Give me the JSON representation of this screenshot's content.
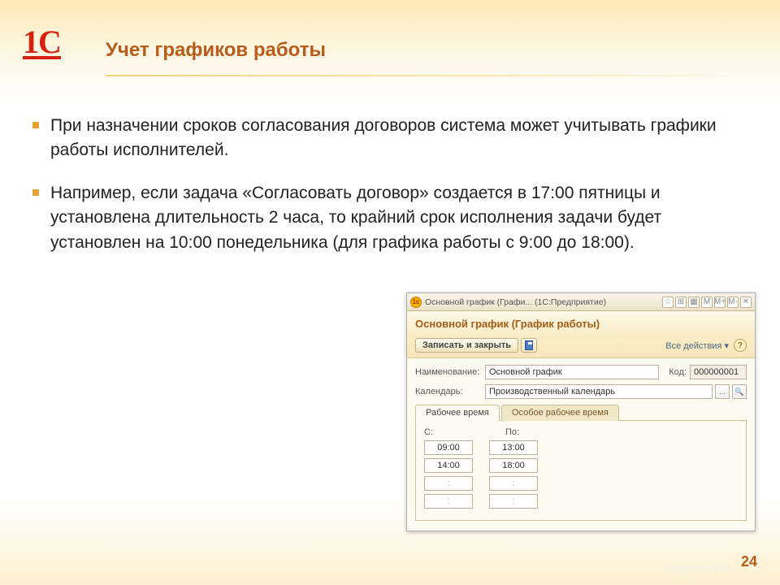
{
  "logo_text": "1C",
  "title": "Учет графиков работы",
  "bullets": [
    "При назначении сроков согласования договоров система может учитывать графики работы исполнителей.",
    "Например, если задача «Согласовать договор» создается в 17:00 пятницы и установлена длительность 2 часа, то крайний срок исполнения задачи будет установлен на 10:00 понедельника (для графика работы с 9:00 до 18:00)."
  ],
  "screenshot": {
    "titlebar": "Основной график (Графи... (1С:Предприятие)",
    "titlebar_buttons": [
      "☆",
      "⊞",
      "▦",
      "M",
      "M+",
      "M-",
      "✕"
    ],
    "header": "Основной график (График работы)",
    "toolbar": {
      "save_close": "Записать и закрыть",
      "all_actions": "Все действия ▾"
    },
    "fields": {
      "name_label": "Наименование:",
      "name_value": "Основной график",
      "code_label": "Код:",
      "code_value": "000000001",
      "calendar_label": "Календарь:",
      "calendar_value": "Производственный календарь"
    },
    "tabs": {
      "work_time": "Рабочее время",
      "special_time": "Особое рабочее время"
    },
    "time": {
      "from_label": "С:",
      "to_label": "По:",
      "rows": [
        {
          "from": "09:00",
          "to": "13:00"
        },
        {
          "from": "14:00",
          "to": "18:00"
        },
        {
          "from": ":",
          "to": ":"
        },
        {
          "from": ":",
          "to": ":"
        }
      ]
    }
  },
  "page_number": "24",
  "watermark": "myshared.ru"
}
